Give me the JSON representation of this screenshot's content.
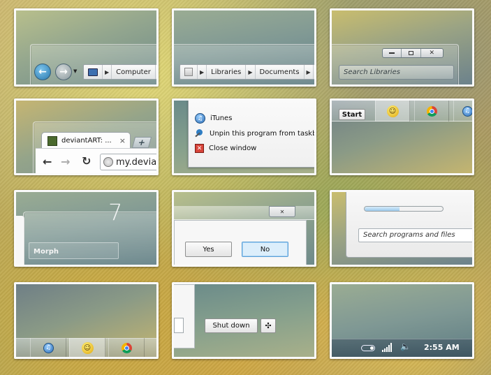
{
  "tile1": {
    "breadcrumb": [
      "Computer"
    ],
    "back_icon": "back-arrow-icon",
    "forward_icon": "forward-arrow-icon"
  },
  "tile2": {
    "breadcrumb": [
      "Libraries",
      "Documents"
    ]
  },
  "tile3": {
    "search_placeholder": "Search Libraries",
    "window_controls": [
      "minimize",
      "maximize",
      "close"
    ]
  },
  "tile4": {
    "tab_title": "deviantART: ...",
    "tab_close": "×",
    "new_tab": "+",
    "address": "my.devia"
  },
  "tile5": {
    "menu": [
      {
        "label": "iTunes",
        "icon": "itunes-icon"
      },
      {
        "label": "Unpin this program from taskba",
        "icon": "unpin-icon"
      },
      {
        "label": "Close window",
        "icon": "close-window-icon"
      }
    ]
  },
  "tile6": {
    "start_label": "Start",
    "pins": [
      "messenger-icon",
      "chrome-icon",
      "itunes-icon"
    ]
  },
  "tile7": {
    "big_number": "7",
    "field_label": "Morph"
  },
  "tile8": {
    "close_glyph": "✕",
    "yes_label": "Yes",
    "no_label": "No"
  },
  "tile9": {
    "progress": 0.45,
    "search_placeholder": "Search programs and files"
  },
  "tile10": {
    "pins": [
      "itunes-icon",
      "messenger-icon",
      "chrome-icon"
    ]
  },
  "tile11": {
    "shutdown_label": "Shut down",
    "options_glyph": "✣"
  },
  "tile12": {
    "clock": "2:55 AM"
  },
  "colors": {
    "nav_blue": "#3d8fc4",
    "button_selected": "#dceefb",
    "button_selected_border": "#5aa0d8"
  }
}
